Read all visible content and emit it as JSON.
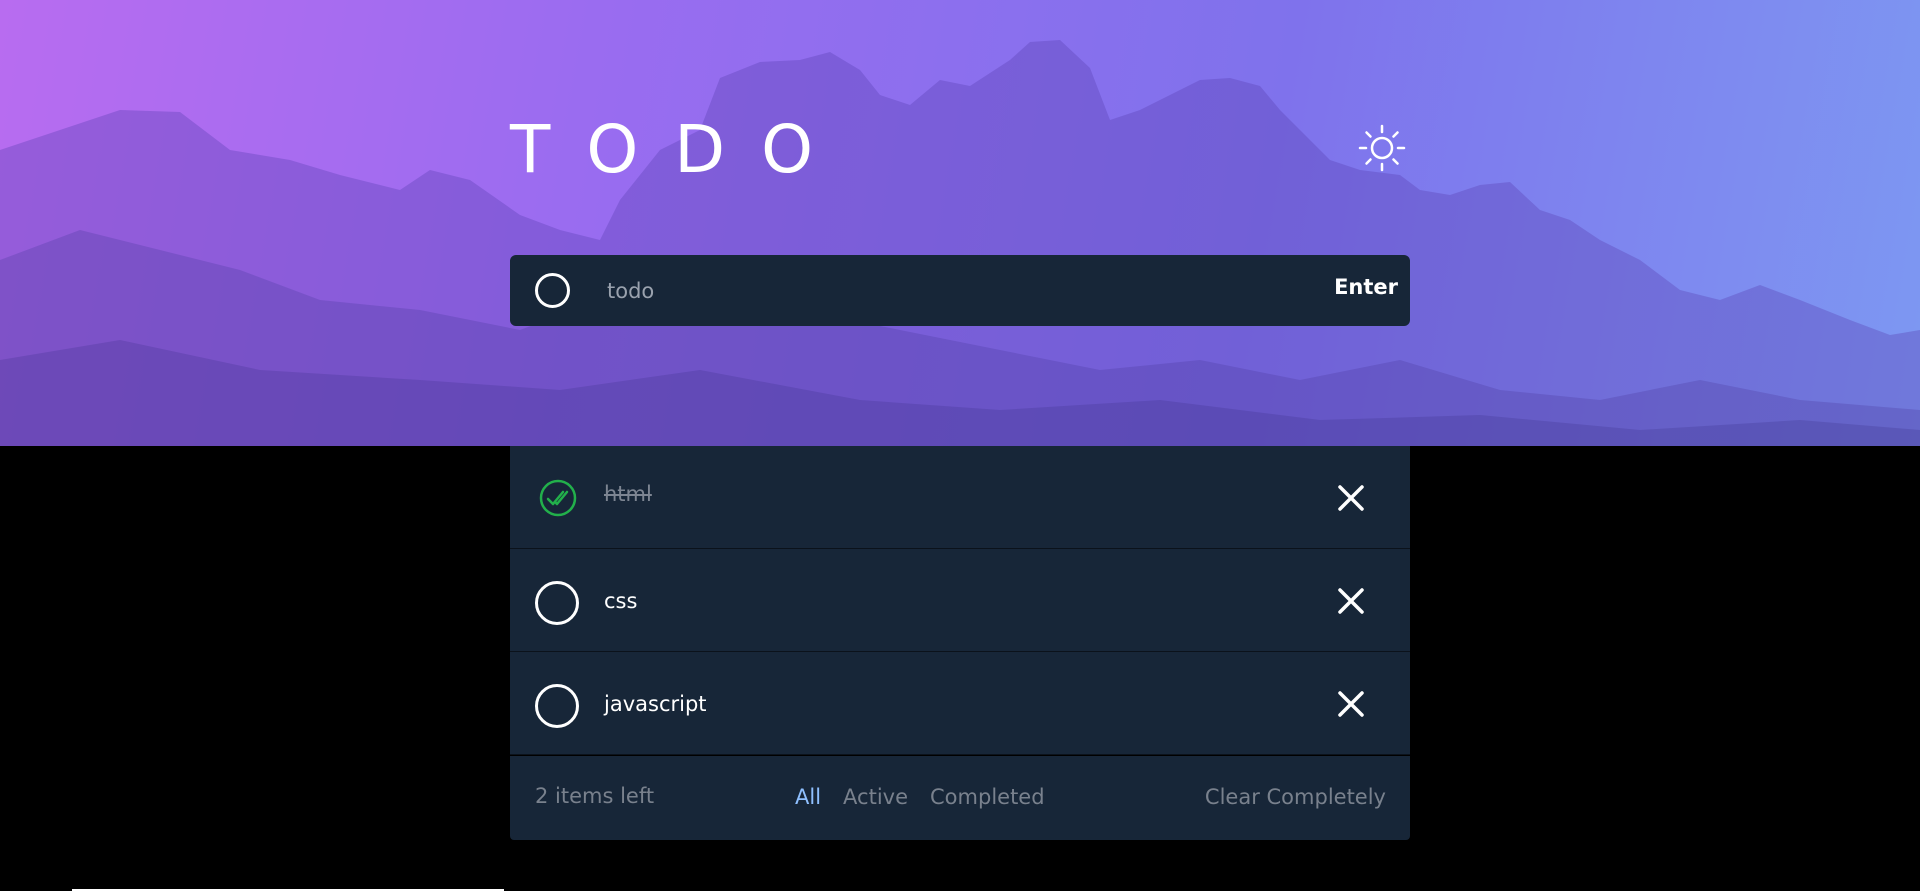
{
  "header": {
    "title": "TODO",
    "theme_icon": "sun-icon"
  },
  "new_todo": {
    "placeholder": "todo",
    "value": "",
    "enter_label": "Enter"
  },
  "todos": [
    {
      "text": "html",
      "completed": true
    },
    {
      "text": "css",
      "completed": false
    },
    {
      "text": "javascript",
      "completed": false
    }
  ],
  "footer": {
    "items_left": "2 items left",
    "filters": [
      {
        "label": "All",
        "active": true
      },
      {
        "label": "Active",
        "active": false
      },
      {
        "label": "Completed",
        "active": false
      }
    ],
    "clear_label": "Clear Completely"
  },
  "colors": {
    "card": "#172638",
    "page_background": "#000000",
    "active_filter": "#8fc0ff",
    "check_green": "#22b04b"
  }
}
